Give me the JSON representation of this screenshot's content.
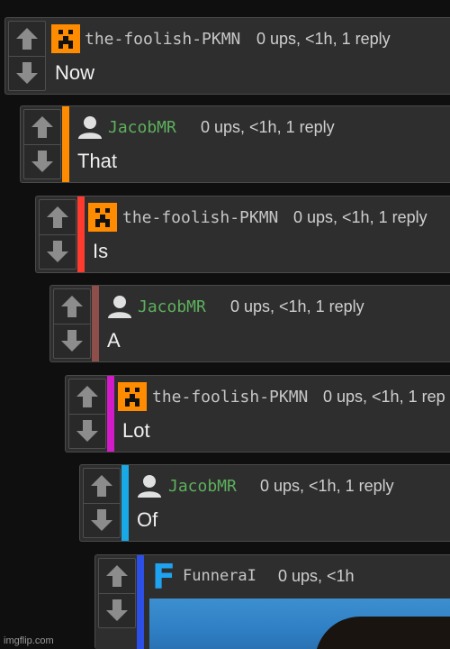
{
  "colors": {
    "depth_bars": [
      "#ff8c00",
      "#ff3b30",
      "#8e4e4a",
      "#d21bc9",
      "#18a9e6",
      "#2c4fe8"
    ],
    "username_default": "#c5c5c5",
    "username_alt": "#5db05d",
    "avatar_orange": "#ff8c00",
    "funneral_letter": "#1fa3f0"
  },
  "comments": [
    {
      "username": "the-foolish-PKMN",
      "avatar": "pixel-face-icon",
      "meta": "0 ups, <1h, 1 reply",
      "text": "Now"
    },
    {
      "username": "JacobMR",
      "avatar": "user-silhouette-icon",
      "meta": "0 ups, <1h, 1 reply",
      "text": "That"
    },
    {
      "username": "the-foolish-PKMN",
      "avatar": "pixel-face-icon",
      "meta": "0 ups, <1h, 1 reply",
      "text": "Is"
    },
    {
      "username": "JacobMR",
      "avatar": "user-silhouette-icon",
      "meta": "0 ups, <1h, 1 reply",
      "text": "A"
    },
    {
      "username": "the-foolish-PKMN",
      "avatar": "pixel-face-icon",
      "meta": "0 ups, <1h, 1 rep",
      "text": "Lot"
    },
    {
      "username": "JacobMR",
      "avatar": "user-silhouette-icon",
      "meta": "0 ups, <1h, 1 reply",
      "text": "Of"
    },
    {
      "username": "FunneraI",
      "avatar": "letter-f-icon",
      "avatar_letter": "F",
      "meta": "0 ups, <1h",
      "text": ""
    }
  ],
  "watermark": "imgflip.com"
}
